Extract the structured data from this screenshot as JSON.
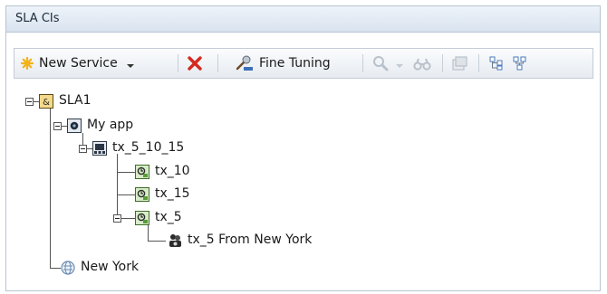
{
  "panel": {
    "title": "SLA CIs"
  },
  "toolbar": {
    "new_service_label": "New Service",
    "fine_tuning_label": "Fine Tuning",
    "icons": [
      "new-star-icon",
      "dropdown-arrow-icon",
      "delete-x-icon",
      "fine-tuning-icon",
      "zoom-icon",
      "dropdown-arrow-icon",
      "binoculars-icon",
      "properties-icon",
      "expand-tree-icon",
      "collapse-tree-icon"
    ]
  },
  "tree": {
    "nodes": [
      {
        "label": "SLA1",
        "icon": "sla-icon",
        "depth": 0,
        "expanded": true
      },
      {
        "label": "My app",
        "icon": "business-app-icon",
        "depth": 1,
        "expanded": true
      },
      {
        "label": "tx_5_10_15",
        "icon": "transaction-group-icon",
        "depth": 2,
        "expanded": true
      },
      {
        "label": "tx_10",
        "icon": "transaction-icon",
        "depth": 3
      },
      {
        "label": "tx_15",
        "icon": "transaction-icon",
        "depth": 3
      },
      {
        "label": "tx_5",
        "icon": "transaction-icon",
        "depth": 3,
        "expanded": true
      },
      {
        "label": "tx_5 From New York",
        "icon": "location-transaction-icon",
        "depth": 4
      },
      {
        "label": "New York",
        "icon": "location-globe-icon",
        "depth": 1
      }
    ]
  },
  "colors": {
    "header_bg": "#d9e3ef",
    "accent_yellow": "#f2b21a",
    "delete_red": "#d42a1f",
    "transaction_green": "#5a9a3a"
  }
}
